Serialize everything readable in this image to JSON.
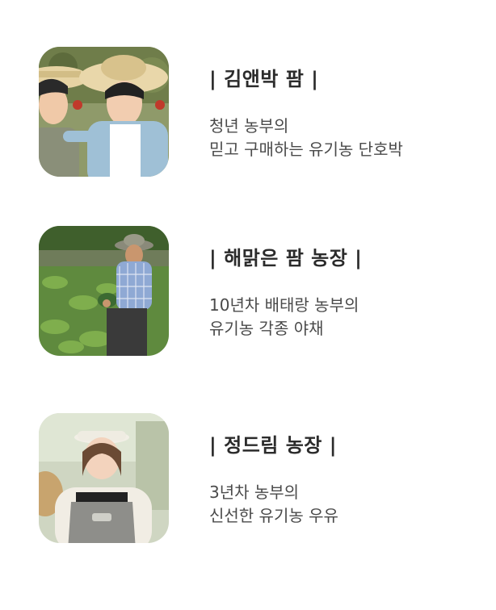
{
  "farms": [
    {
      "name": "| 김앤박 팜 |",
      "desc": [
        "청년 농부의",
        "믿고 구매하는 유기농 단호박"
      ]
    },
    {
      "name": "| 해맑은 팜 농장 |",
      "desc": [
        "10년차 배태랑 농부의",
        "유기농 각종 야채"
      ]
    },
    {
      "name": "| 정드림 농장 |",
      "desc": [
        "3년차 농부의",
        "신선한 유기농 우유"
      ]
    }
  ],
  "colors": {
    "background": "#ffffff",
    "title_text": "#2b2b2b",
    "desc_text": "#4a4a4a"
  }
}
